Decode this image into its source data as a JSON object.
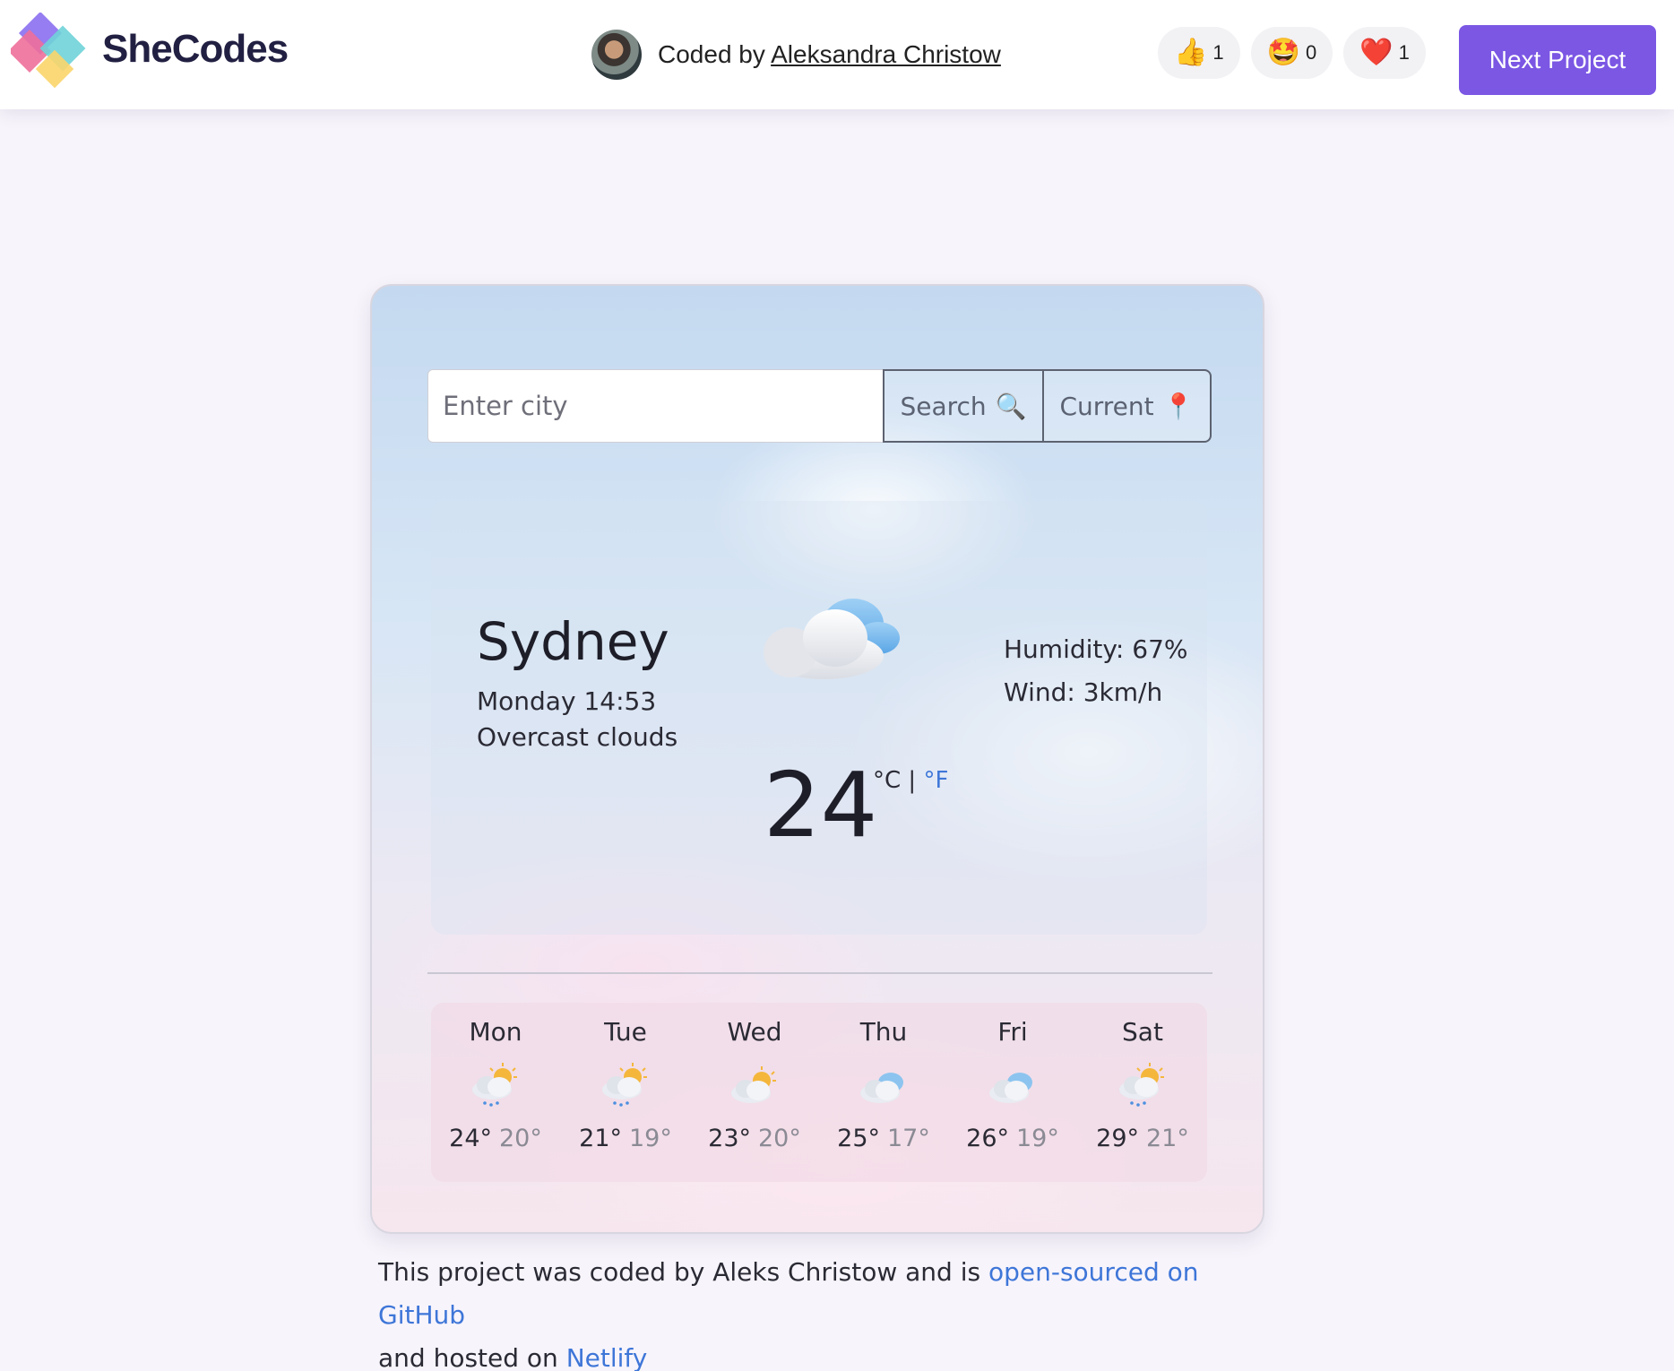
{
  "brand": {
    "name": "SheCodes"
  },
  "author": {
    "prefix": "Coded by",
    "name": "Aleksandra Christow"
  },
  "reactions": [
    {
      "icon": "thumbs-up-icon",
      "emoji": "👍",
      "count": "1"
    },
    {
      "icon": "star-struck-icon",
      "emoji": "🤩",
      "count": "0"
    },
    {
      "icon": "heart-icon",
      "emoji": "❤️",
      "count": "1"
    }
  ],
  "next_project": {
    "label": "Next Project"
  },
  "search": {
    "placeholder": "Enter city",
    "search_label": "Search",
    "search_icon": "🔍",
    "current_label": "Current",
    "current_icon": "📍"
  },
  "weather": {
    "city": "Sydney",
    "date": "Monday 14:53",
    "description": "Overcast clouds",
    "humidity": "Humidity: 67%",
    "wind": "Wind: 3km/h",
    "temperature": "24",
    "unit_c": "°C",
    "unit_sep": "|",
    "unit_f": "°F",
    "icon": "overcast-cloud-icon"
  },
  "forecast": [
    {
      "day": "Mon",
      "max": "24°",
      "min": "20°",
      "icon": "sun-cloud-rain-icon"
    },
    {
      "day": "Tue",
      "max": "21°",
      "min": "19°",
      "icon": "sun-cloud-rain-icon"
    },
    {
      "day": "Wed",
      "max": "23°",
      "min": "20°",
      "icon": "sun-cloud-icon"
    },
    {
      "day": "Thu",
      "max": "25°",
      "min": "17°",
      "icon": "cloud-icon"
    },
    {
      "day": "Fri",
      "max": "26°",
      "min": "19°",
      "icon": "cloud-icon"
    },
    {
      "day": "Sat",
      "max": "29°",
      "min": "21°",
      "icon": "sun-cloud-rain-icon"
    }
  ],
  "footer": {
    "text1": "This project was coded by Aleks Christow and is ",
    "link1": "open-sourced on GitHub",
    "text2": "and hosted on ",
    "link2": "Netlify"
  },
  "colors": {
    "accent": "#7b57e4",
    "link": "#3e76d8"
  }
}
